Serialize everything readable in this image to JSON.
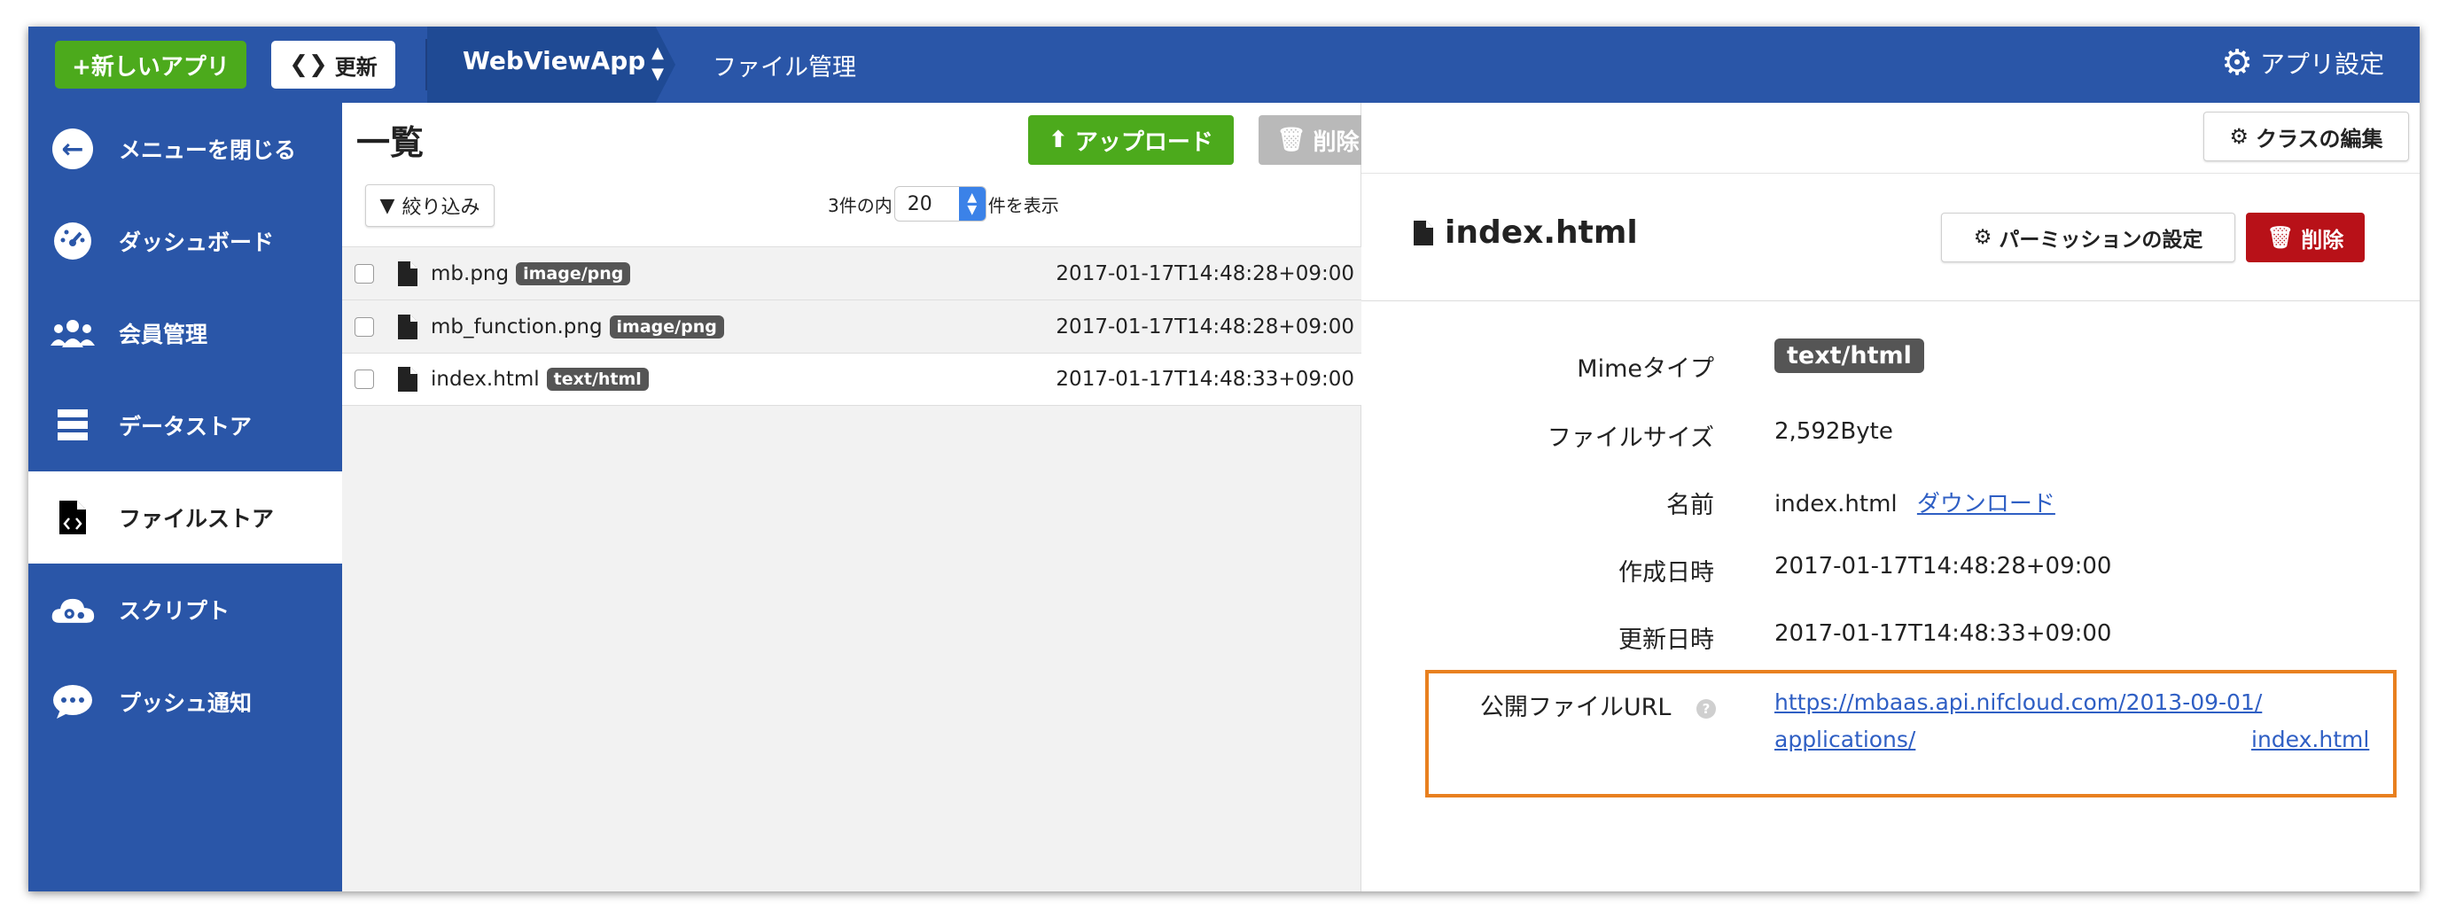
{
  "topbar": {
    "new_app_label": "+新しいアプリ",
    "refresh_label": "更新",
    "app_name": "WebViewApp",
    "page_name": "ファイル管理",
    "app_settings_label": "アプリ設定"
  },
  "sidebar": {
    "items": [
      {
        "label": "メニューを閉じる",
        "icon": "arrow-left-icon"
      },
      {
        "label": "ダッシュボード",
        "icon": "dashboard-icon"
      },
      {
        "label": "会員管理",
        "icon": "users-icon"
      },
      {
        "label": "データストア",
        "icon": "datastore-icon"
      },
      {
        "label": "ファイルストア",
        "icon": "file-code-icon",
        "active": true
      },
      {
        "label": "スクリプト",
        "icon": "cloud-gear-icon"
      },
      {
        "label": "プッシュ通知",
        "icon": "chat-bubble-icon"
      }
    ]
  },
  "list": {
    "title": "一覧",
    "upload_label": "アップロード",
    "delete_label": "削除",
    "filter_label": "絞り込み",
    "count_prefix": "3件の内",
    "per_page": "20",
    "count_suffix": "件を表示",
    "files": [
      {
        "name": "mb.png",
        "type": "image/png",
        "date": "2017-01-17T14:48:28+09:00"
      },
      {
        "name": "mb_function.png",
        "type": "image/png",
        "date": "2017-01-17T14:48:28+09:00"
      },
      {
        "name": "index.html",
        "type": "text/html",
        "date": "2017-01-17T14:48:33+09:00"
      }
    ]
  },
  "detail": {
    "class_edit_label": "クラスの編集",
    "title": "index.html",
    "permission_label": "パーミッションの設定",
    "delete_label": "削除",
    "mime_label": "Mimeタイプ",
    "mime_value": "text/html",
    "size_label": "ファイルサイズ",
    "size_value": "2,592Byte",
    "name_label": "名前",
    "name_value": "index.html",
    "download_label": "ダウンロード",
    "created_label": "作成日時",
    "created_value": "2017-01-17T14:48:28+09:00",
    "updated_label": "更新日時",
    "updated_value": "2017-01-17T14:48:33+09:00",
    "url_label": "公開ファイルURL",
    "url_line1": "https://mbaas.api.nifcloud.com/2013-09-01/",
    "url_line2a": "applications/",
    "url_line2b": "index.html"
  },
  "colors": {
    "brand_blue": "#2a56a8",
    "green": "#4caa1c",
    "danger": "#b81118",
    "highlight": "#e8801f"
  }
}
